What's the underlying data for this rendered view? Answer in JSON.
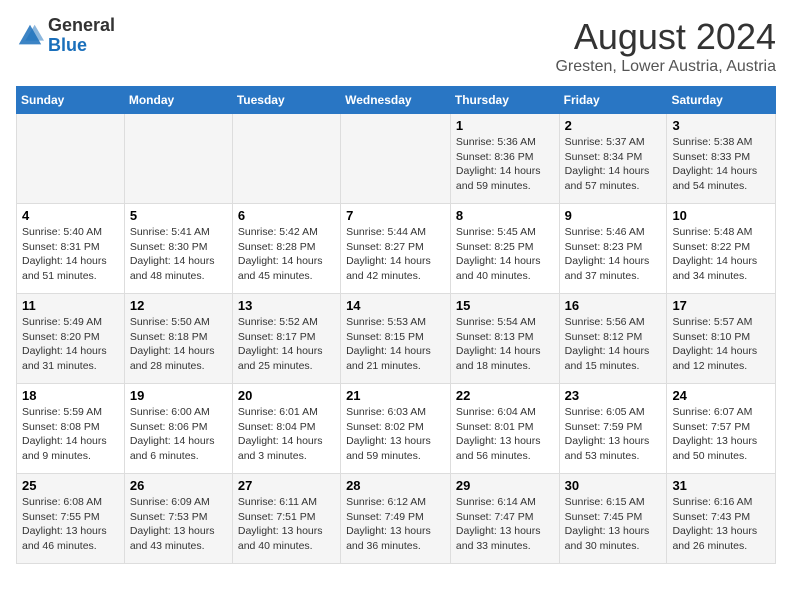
{
  "logo": {
    "general": "General",
    "blue": "Blue"
  },
  "header": {
    "title": "August 2024",
    "subtitle": "Gresten, Lower Austria, Austria"
  },
  "weekdays": [
    "Sunday",
    "Monday",
    "Tuesday",
    "Wednesday",
    "Thursday",
    "Friday",
    "Saturday"
  ],
  "weeks": [
    [
      {
        "day": "",
        "info": ""
      },
      {
        "day": "",
        "info": ""
      },
      {
        "day": "",
        "info": ""
      },
      {
        "day": "",
        "info": ""
      },
      {
        "day": "1",
        "info": "Sunrise: 5:36 AM\nSunset: 8:36 PM\nDaylight: 14 hours and 59 minutes."
      },
      {
        "day": "2",
        "info": "Sunrise: 5:37 AM\nSunset: 8:34 PM\nDaylight: 14 hours and 57 minutes."
      },
      {
        "day": "3",
        "info": "Sunrise: 5:38 AM\nSunset: 8:33 PM\nDaylight: 14 hours and 54 minutes."
      }
    ],
    [
      {
        "day": "4",
        "info": "Sunrise: 5:40 AM\nSunset: 8:31 PM\nDaylight: 14 hours and 51 minutes."
      },
      {
        "day": "5",
        "info": "Sunrise: 5:41 AM\nSunset: 8:30 PM\nDaylight: 14 hours and 48 minutes."
      },
      {
        "day": "6",
        "info": "Sunrise: 5:42 AM\nSunset: 8:28 PM\nDaylight: 14 hours and 45 minutes."
      },
      {
        "day": "7",
        "info": "Sunrise: 5:44 AM\nSunset: 8:27 PM\nDaylight: 14 hours and 42 minutes."
      },
      {
        "day": "8",
        "info": "Sunrise: 5:45 AM\nSunset: 8:25 PM\nDaylight: 14 hours and 40 minutes."
      },
      {
        "day": "9",
        "info": "Sunrise: 5:46 AM\nSunset: 8:23 PM\nDaylight: 14 hours and 37 minutes."
      },
      {
        "day": "10",
        "info": "Sunrise: 5:48 AM\nSunset: 8:22 PM\nDaylight: 14 hours and 34 minutes."
      }
    ],
    [
      {
        "day": "11",
        "info": "Sunrise: 5:49 AM\nSunset: 8:20 PM\nDaylight: 14 hours and 31 minutes."
      },
      {
        "day": "12",
        "info": "Sunrise: 5:50 AM\nSunset: 8:18 PM\nDaylight: 14 hours and 28 minutes."
      },
      {
        "day": "13",
        "info": "Sunrise: 5:52 AM\nSunset: 8:17 PM\nDaylight: 14 hours and 25 minutes."
      },
      {
        "day": "14",
        "info": "Sunrise: 5:53 AM\nSunset: 8:15 PM\nDaylight: 14 hours and 21 minutes."
      },
      {
        "day": "15",
        "info": "Sunrise: 5:54 AM\nSunset: 8:13 PM\nDaylight: 14 hours and 18 minutes."
      },
      {
        "day": "16",
        "info": "Sunrise: 5:56 AM\nSunset: 8:12 PM\nDaylight: 14 hours and 15 minutes."
      },
      {
        "day": "17",
        "info": "Sunrise: 5:57 AM\nSunset: 8:10 PM\nDaylight: 14 hours and 12 minutes."
      }
    ],
    [
      {
        "day": "18",
        "info": "Sunrise: 5:59 AM\nSunset: 8:08 PM\nDaylight: 14 hours and 9 minutes."
      },
      {
        "day": "19",
        "info": "Sunrise: 6:00 AM\nSunset: 8:06 PM\nDaylight: 14 hours and 6 minutes."
      },
      {
        "day": "20",
        "info": "Sunrise: 6:01 AM\nSunset: 8:04 PM\nDaylight: 14 hours and 3 minutes."
      },
      {
        "day": "21",
        "info": "Sunrise: 6:03 AM\nSunset: 8:02 PM\nDaylight: 13 hours and 59 minutes."
      },
      {
        "day": "22",
        "info": "Sunrise: 6:04 AM\nSunset: 8:01 PM\nDaylight: 13 hours and 56 minutes."
      },
      {
        "day": "23",
        "info": "Sunrise: 6:05 AM\nSunset: 7:59 PM\nDaylight: 13 hours and 53 minutes."
      },
      {
        "day": "24",
        "info": "Sunrise: 6:07 AM\nSunset: 7:57 PM\nDaylight: 13 hours and 50 minutes."
      }
    ],
    [
      {
        "day": "25",
        "info": "Sunrise: 6:08 AM\nSunset: 7:55 PM\nDaylight: 13 hours and 46 minutes."
      },
      {
        "day": "26",
        "info": "Sunrise: 6:09 AM\nSunset: 7:53 PM\nDaylight: 13 hours and 43 minutes."
      },
      {
        "day": "27",
        "info": "Sunrise: 6:11 AM\nSunset: 7:51 PM\nDaylight: 13 hours and 40 minutes."
      },
      {
        "day": "28",
        "info": "Sunrise: 6:12 AM\nSunset: 7:49 PM\nDaylight: 13 hours and 36 minutes."
      },
      {
        "day": "29",
        "info": "Sunrise: 6:14 AM\nSunset: 7:47 PM\nDaylight: 13 hours and 33 minutes."
      },
      {
        "day": "30",
        "info": "Sunrise: 6:15 AM\nSunset: 7:45 PM\nDaylight: 13 hours and 30 minutes."
      },
      {
        "day": "31",
        "info": "Sunrise: 6:16 AM\nSunset: 7:43 PM\nDaylight: 13 hours and 26 minutes."
      }
    ]
  ]
}
